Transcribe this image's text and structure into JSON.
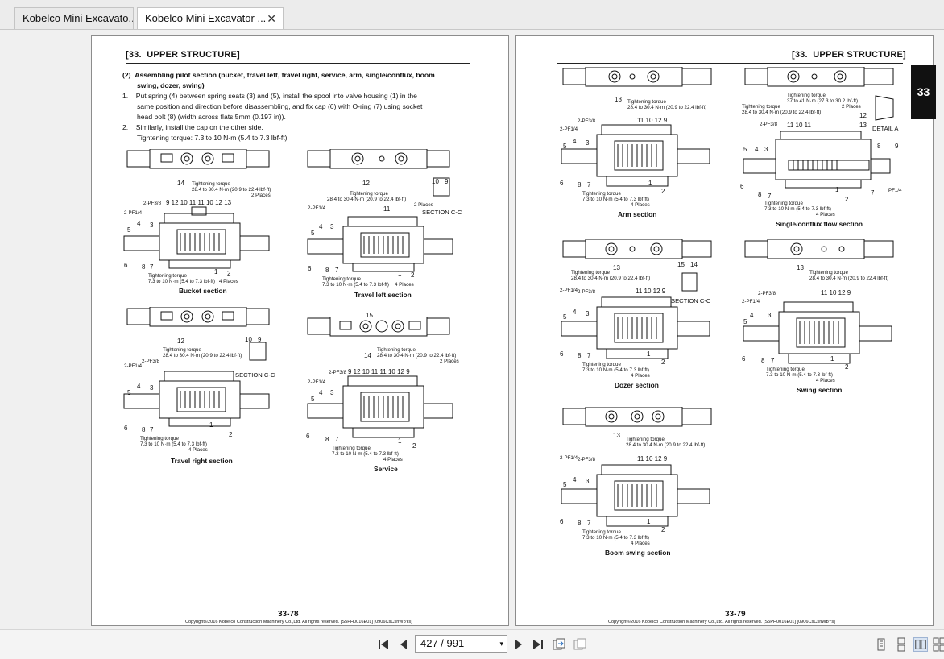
{
  "tabs": [
    {
      "label": "Kobelco Mini Excavato..."
    },
    {
      "label": "Kobelco Mini Excavator ...",
      "close": "✕"
    }
  ],
  "left_page": {
    "header": "[33.  UPPER STRUCTURE]",
    "heading_line1": "(2)  Assembling pilot section (bucket, travel left, travel right, service, arm, single/conflux, boom",
    "heading_line2": "swing, dozer, swing)",
    "step1_line1": "1.    Put spring (4) between spring seats (3) and (5), install the spool into valve housing (1) in the",
    "step1_line2": "same position and direction before disassembling, and fix cap (6) with O-ring (7) using socket",
    "step1_line3": "head bolt (8) (width across flats 5mm (0.197 in)).",
    "step2_line1": "2.    Similarly, install the cap on the other side.",
    "step2_line2": "Tightening torque: 7.3 to 10 N-m (5.4 to 7.3 lbf-ft)",
    "captions": {
      "bucket": "Bucket section",
      "travel_left": "Travel left section",
      "travel_right": "Travel right section",
      "service": "Service"
    },
    "page_number": "33-78",
    "copyright": "Copyright©2016 Kobelco Construction Machinery Co.,Ltd. All rights reserved. [S5PH0016E01] [0906CsCsnWbYs]"
  },
  "right_page": {
    "header": "[33.  UPPER STRUCTURE]",
    "captions": {
      "arm": "Arm section",
      "single_conflux": "Single/conflux flow section",
      "dozer": "Dozer section",
      "swing": "Swing section",
      "boom_swing": "Boom swing section"
    },
    "page_number": "33-79",
    "copyright": "Copyright©2016 Kobelco Construction Machinery Co.,Ltd. All rights reserved. [S5PH0016E01] [0906CsCsnWbYs]",
    "side_tab": "33"
  },
  "diagram_text": {
    "tt_label": "Tightening torque",
    "tt_high": "28.4 to 30.4 N·m (20.9 to 22.4 lbf·ft)",
    "tt_high2": "2 Places",
    "tt_low": "7.3 to 10 N·m (5.4 to 7.3 lbf·ft)",
    "tt_low4": "4 Places",
    "tt_mid": "37 to 41 N·m (27.3 to 30.2 lbf·ft)",
    "section_cc": "SECTION C-C",
    "detail_a": "DETAIL A",
    "pf38": "2-PF3/8",
    "pf14": "2-PF1/4",
    "pf1": "PF1/4",
    "bucket_nums": "9  12 10 11  11 10 12 13",
    "arm_nums": "11 10 12  9",
    "service_nums": "9  12 10 11  11 10 12  9",
    "sc_nums": "11        10        11"
  },
  "toolbar": {
    "page_value": "427 / 991",
    "dropdown_icon": "▾"
  }
}
